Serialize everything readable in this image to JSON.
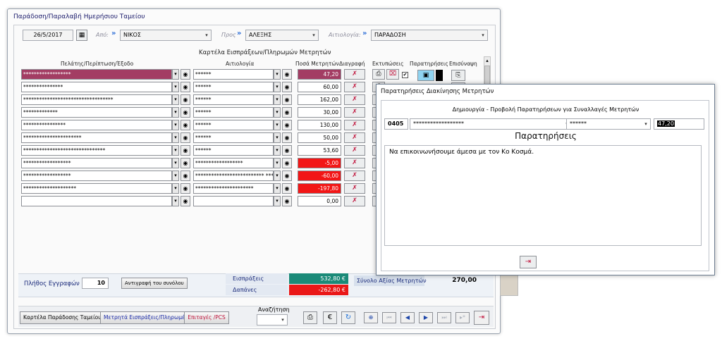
{
  "window": {
    "title": "Παράδοση/Παραλαβή Ημερήσιου Ταμείου"
  },
  "filters": {
    "date": "26/5/2017",
    "from_label": "Από:",
    "from_value": "ΝΙΚΟΣ",
    "to_label": "Προς",
    "to_value": "ΑΛΕΞΗΣ",
    "reason_label": "Αιτιολογία:",
    "reason_value": "ΠΑΡΑΔΟΣΗ"
  },
  "grid": {
    "title": "Καρτέλα Εισπράξεων/Πληρωμών Μετρητών",
    "headers": {
      "customer": "Πελάτης/Περίπτωση/Έξοδο",
      "reason": "Αιτιολογία",
      "amount": "Ποσά Μετρητών",
      "delete": "Διαγραφή",
      "print": "Εκτυπώσεις",
      "notes": "Παρατηρήσεις",
      "attach": "Επισύναψη"
    },
    "rows": [
      {
        "customer": "******************",
        "reason": "******",
        "amount": "47,20",
        "selected": true,
        "negative": false
      },
      {
        "customer": "***************",
        "reason": "******",
        "amount": "60,00",
        "selected": false,
        "negative": false
      },
      {
        "customer": "**********************************",
        "reason": "******",
        "amount": "162,00",
        "selected": false,
        "negative": false
      },
      {
        "customer": "*************",
        "reason": "******",
        "amount": "30,00",
        "selected": false,
        "negative": false
      },
      {
        "customer": "****************",
        "reason": "******",
        "amount": "130,00",
        "selected": false,
        "negative": false
      },
      {
        "customer": "**********************",
        "reason": "******",
        "amount": "50,00",
        "selected": false,
        "negative": false
      },
      {
        "customer": "*******************************",
        "reason": "******",
        "amount": "53,60",
        "selected": false,
        "negative": false
      },
      {
        "customer": "******************",
        "reason": "******************",
        "amount": "-5,00",
        "selected": false,
        "negative": true
      },
      {
        "customer": "******************",
        "reason": "************************** ***************",
        "amount": "-60,00",
        "selected": false,
        "negative": true
      },
      {
        "customer": "********************",
        "reason": "**********************",
        "amount": "-197,80",
        "selected": false,
        "negative": true
      },
      {
        "customer": "",
        "reason": "",
        "amount": "0,00",
        "selected": false,
        "negative": false
      }
    ]
  },
  "summary": {
    "record_count_label": "Πλήθος Εγγραφών",
    "record_count": "10",
    "copy_total_button": "Αντιγραφή του συνόλου",
    "receipts_label": "Εισπράξεις",
    "receipts_value": "532,80 €",
    "expenses_label": "Δαπάνες",
    "expenses_value": "-262,80 €",
    "total_label": "Σύνολο Αξίας Μετρητών",
    "total_value": "270,00"
  },
  "footer": {
    "cash_card_button": "Καρτέλα Παράδοσης Ταμείου",
    "cash_counter_button": "Μετρητά Εισπράξεις/Πληρωμές",
    "cheques_button": "Επιταγές /PCS",
    "search_label": "Αναζήτηση"
  },
  "popup": {
    "title": "Παρατηρήσεις Διακίνησης Μετρητών",
    "subtitle": "Δημιουργία - Προβολή Παρατηρήσεων για Συναλλαγές Μετρητών",
    "code": "0405",
    "customer": "******************",
    "reason": "******",
    "amount": "47,20",
    "notes_heading": "Παρατηρήσεις",
    "notes_text": "Να επικοινωνήσουμε άμεσα με τον Κο Κοσμά."
  },
  "colors": {
    "selected_row": "#a33d63",
    "negative": "#f21616",
    "receipts": "#1a8a78",
    "accent_blue": "#2a6cd6"
  }
}
